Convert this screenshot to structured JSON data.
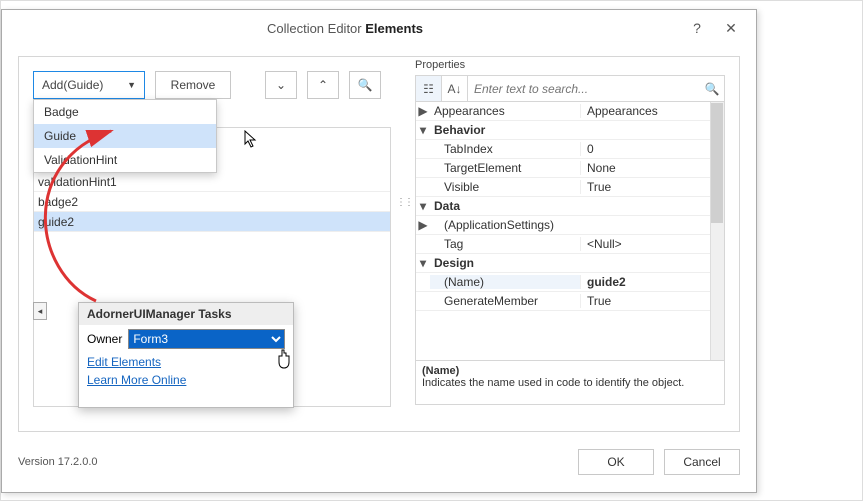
{
  "external_tag": "adornerUIManager1",
  "dialog": {
    "title_prefix": "Collection Editor ",
    "title_bold": "Elements",
    "help": "?",
    "close": "✕"
  },
  "toolbar": {
    "add_label": "Add(Guide)",
    "remove_label": "Remove",
    "dropdown": [
      "Badge",
      "Guide",
      "ValidationHint"
    ],
    "dropdown_selected": "Guide"
  },
  "list": {
    "items": [
      "validationHint1",
      "badge2",
      "guide2"
    ],
    "selected": "guide2"
  },
  "smart": {
    "title": "AdornerUIManager Tasks",
    "owner_label": "Owner",
    "owner_value": "Form3",
    "link_edit": "Edit Elements",
    "link_learn": "Learn More Online"
  },
  "props": {
    "label": "Properties",
    "search_placeholder": "Enter text to search...",
    "rows": [
      {
        "t": "row",
        "exp": "▶",
        "name": "Appearances",
        "value": "Appearances"
      },
      {
        "t": "cat",
        "exp": "▾",
        "name": "Behavior"
      },
      {
        "t": "row",
        "name": "TabIndex",
        "value": "0",
        "indent": true
      },
      {
        "t": "row",
        "name": "TargetElement",
        "value": "None",
        "indent": true
      },
      {
        "t": "row",
        "name": "Visible",
        "value": "True",
        "indent": true
      },
      {
        "t": "cat",
        "exp": "▾",
        "name": "Data"
      },
      {
        "t": "row",
        "exp": "▶",
        "name": "(ApplicationSettings)",
        "indent": true
      },
      {
        "t": "row",
        "name": "Tag",
        "value": "<Null>",
        "indent": true
      },
      {
        "t": "cat",
        "exp": "▾",
        "name": "Design"
      },
      {
        "t": "row",
        "name": "(Name)",
        "value": "guide2",
        "indent": true,
        "selected": true
      },
      {
        "t": "row",
        "name": "GenerateMember",
        "value": "True",
        "indent": true
      }
    ],
    "desc_name": "(Name)",
    "desc_text": "Indicates the name used in code to identify the object."
  },
  "footer": {
    "version": "Version 17.2.0.0",
    "ok": "OK",
    "cancel": "Cancel"
  }
}
